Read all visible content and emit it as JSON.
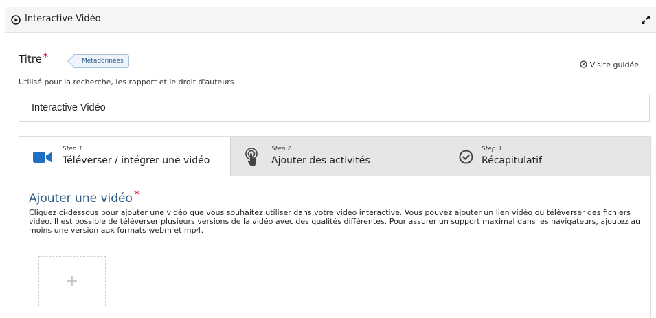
{
  "header": {
    "title": "Interactive Vidéo",
    "play_icon": "circle-play-icon",
    "expand_icon": "fullscreen-expand-icon"
  },
  "title_field": {
    "label": "Titre",
    "required_mark": "*",
    "metadata_button": "Métadonnées",
    "guided_tour": "Visite guidée",
    "description": "Utilisé pour la recherche, les rapport et le droit d'auteurs",
    "value": "Interactive Vidéo"
  },
  "wizard": {
    "tabs": [
      {
        "step": "Step 1",
        "label": "Téléverser / intégrer une vidéo",
        "icon": "video-camera-icon",
        "active": true
      },
      {
        "step": "Step 2",
        "label": "Ajouter des activités",
        "icon": "touch-pointer-icon",
        "active": false
      },
      {
        "step": "Step 3",
        "label": "Récapitulatif",
        "icon": "check-circle-icon",
        "active": false
      }
    ],
    "content": {
      "heading": "Ajouter une vidéo",
      "required_mark": "*",
      "description": "Cliquez ci-dessous pour ajouter une vidéo que vous souhaitez utiliser dans votre vidéo interactive. Vous pouvez ajouter un lien vidéo ou téléverser des fichiers vidéo. Il est possible de téléverser plusieurs versions de la vidéo avec des qualités différentes. Pour assurer un support maximal dans les navigateurs, ajoutez au moins une version aux formats webm et mp4.",
      "add_button_symbol": "+"
    }
  },
  "colors": {
    "accent_blue": "#2d5c86",
    "video_icon_blue": "#1f6fc5",
    "required_red": "#d0021b",
    "tab_inactive_bg": "#e6e6e6"
  }
}
